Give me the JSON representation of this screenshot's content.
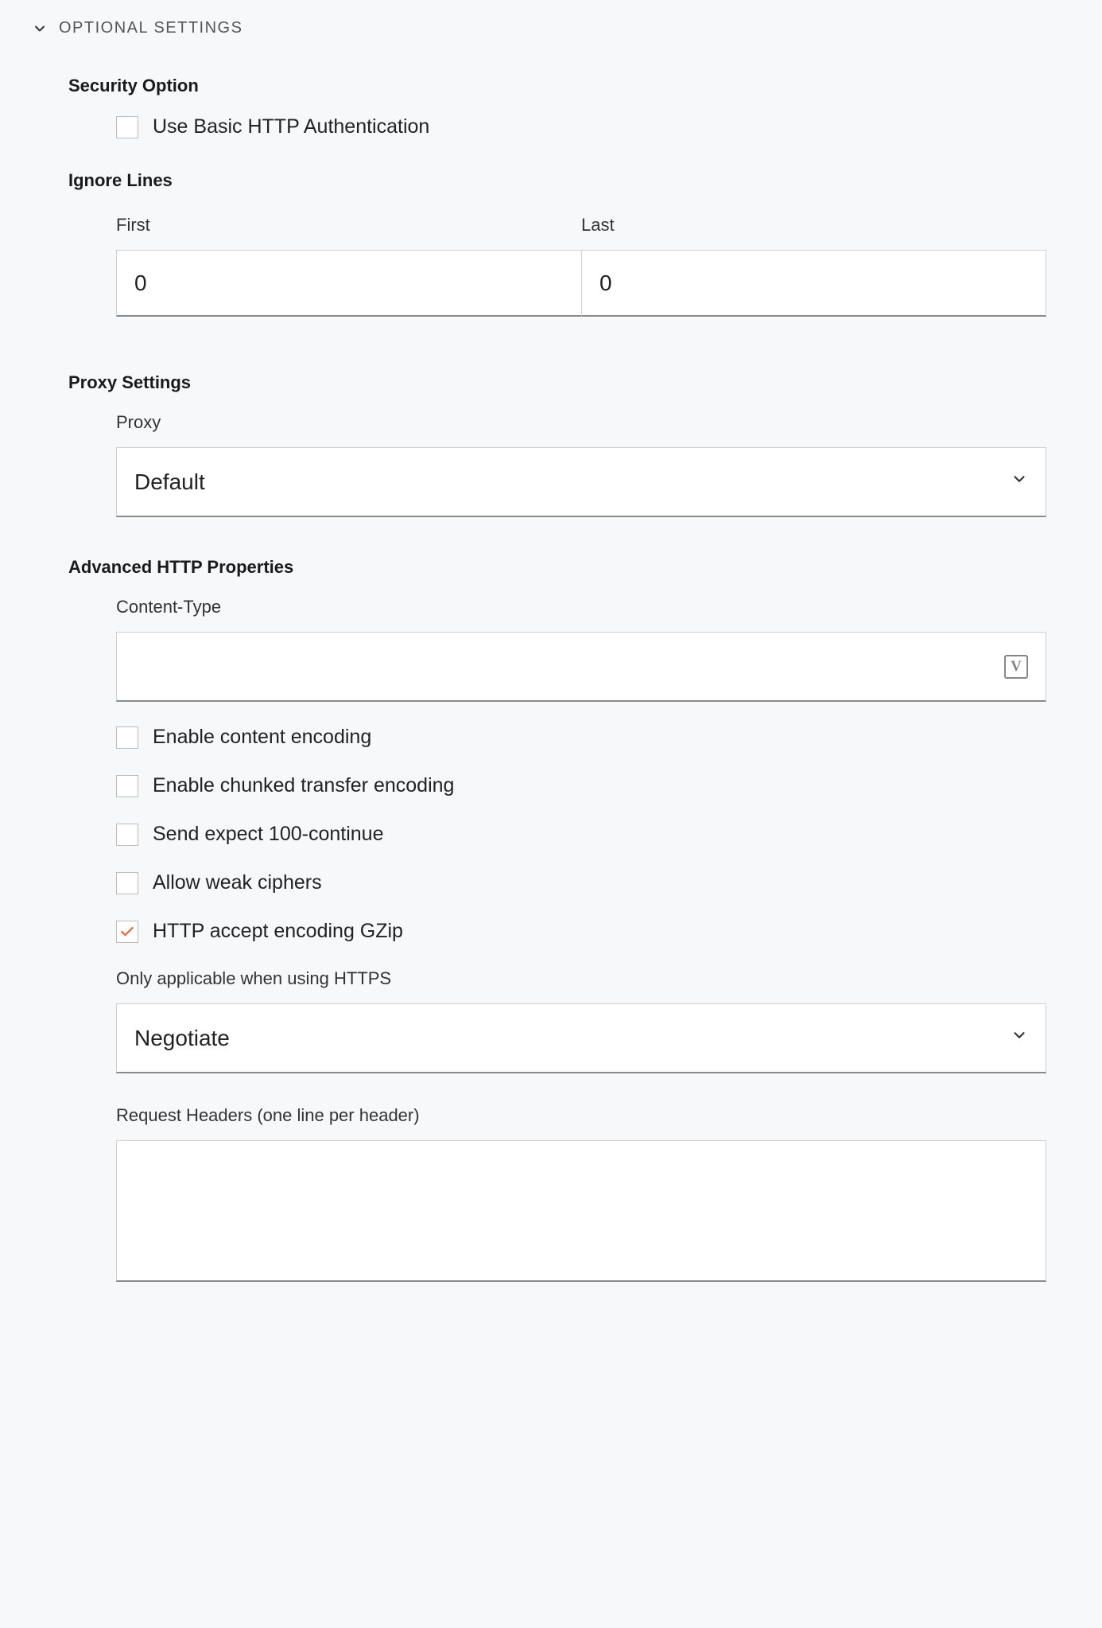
{
  "header": {
    "title": "OPTIONAL SETTINGS"
  },
  "security": {
    "title": "Security Option",
    "basic_auth_label": "Use Basic HTTP Authentication",
    "basic_auth_checked": false
  },
  "ignore_lines": {
    "title": "Ignore Lines",
    "first_label": "First",
    "first_value": "0",
    "last_label": "Last",
    "last_value": "0"
  },
  "proxy": {
    "title": "Proxy Settings",
    "label": "Proxy",
    "value": "Default"
  },
  "advanced": {
    "title": "Advanced HTTP Properties",
    "content_type_label": "Content-Type",
    "content_type_value": "",
    "variable_icon_glyph": "V",
    "checkboxes": [
      {
        "label": "Enable content encoding",
        "checked": false
      },
      {
        "label": "Enable chunked transfer encoding",
        "checked": false
      },
      {
        "label": "Send expect 100-continue",
        "checked": false
      },
      {
        "label": "Allow weak ciphers",
        "checked": false
      },
      {
        "label": "HTTP accept encoding GZip",
        "checked": true
      }
    ],
    "https_label": "Only applicable when using HTTPS",
    "https_value": "Negotiate",
    "request_headers_label": "Request Headers (one line per header)",
    "request_headers_value": ""
  }
}
